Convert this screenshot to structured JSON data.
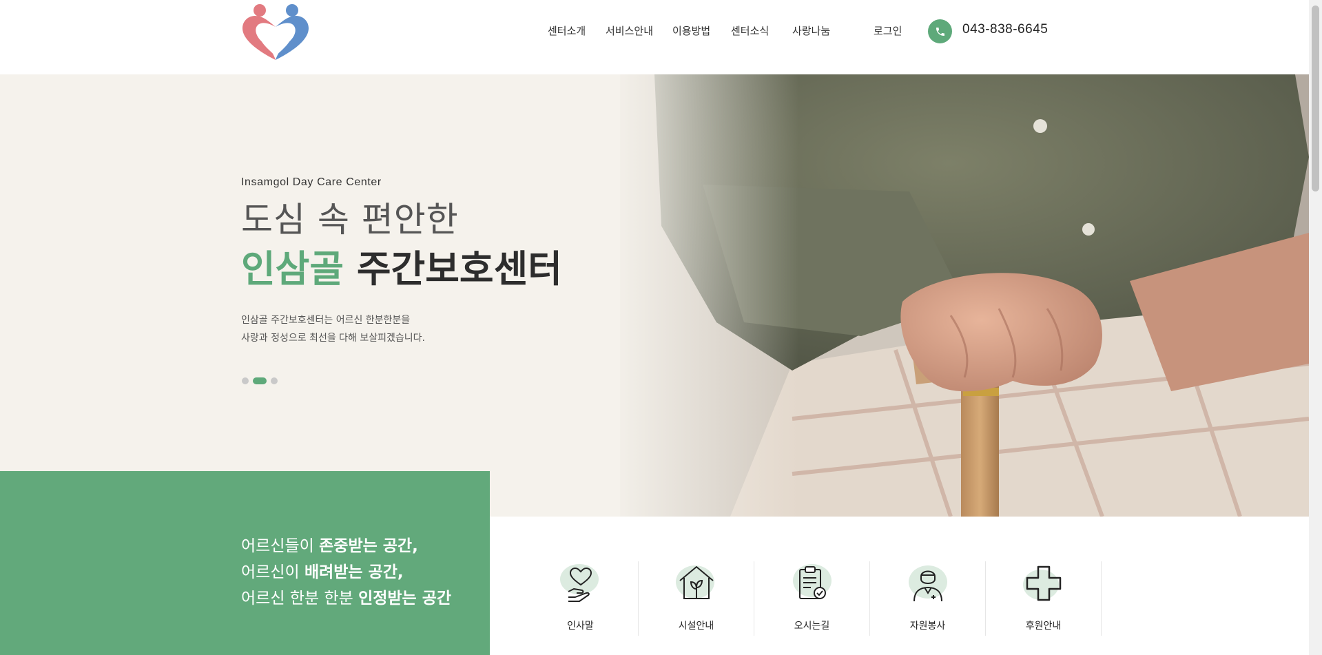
{
  "header": {
    "logo_alt": "heart logo",
    "nav": [
      "센터소개",
      "서비스안내",
      "이용방법",
      "센터소식",
      "사랑나눔"
    ],
    "login": "로그인",
    "phone": "043-838-6645"
  },
  "hero": {
    "eyebrow": "Insamgol Day Care Center",
    "line1": "도심 속 편안한",
    "line2_accent": "인삼골",
    "line2_rest": " 주간보호센터",
    "desc_line1": "인삼골 주간보호센터는 어르신 한분한분을",
    "desc_line2": "사랑과 정성으로 최선을 다해 보살피겠습니다.",
    "slides": 3,
    "active_slide": 2
  },
  "band": {
    "line1_light": "어르신들이 ",
    "line1_bold": "존중받는 공간,",
    "line2_light": "어르신이 ",
    "line2_bold": "배려받는 공간,",
    "line3_light": "어르신 한분 한분 ",
    "line3_bold": "인정받는 공간"
  },
  "quick_links": [
    {
      "label": "인사말",
      "icon": "heart-hand-icon"
    },
    {
      "label": "시설안내",
      "icon": "house-plant-icon"
    },
    {
      "label": "오시는길",
      "icon": "clipboard-check-icon"
    },
    {
      "label": "자원봉사",
      "icon": "nurse-icon"
    },
    {
      "label": "후원안내",
      "icon": "medical-cross-icon"
    }
  ],
  "colors": {
    "accent": "#5ea97a",
    "hero_bg": "#f5f2ec",
    "band_bg": "#62a97b",
    "logo_pink": "#e27a80",
    "logo_blue": "#5f8fcb"
  }
}
